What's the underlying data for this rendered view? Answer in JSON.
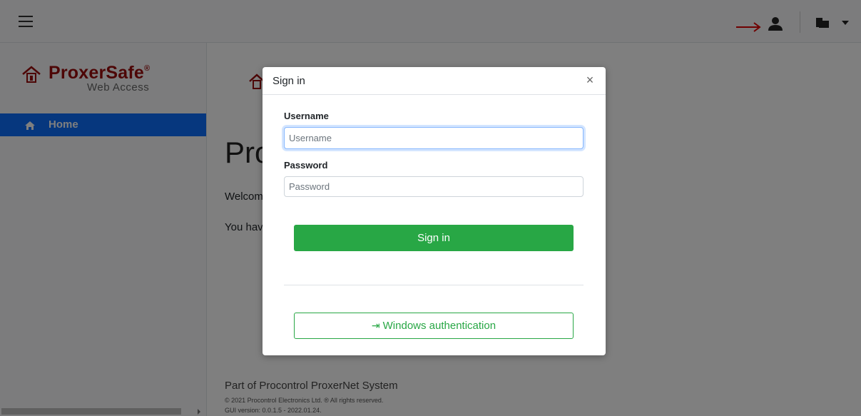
{
  "topbar": {
    "menu_icon": "hamburger-icon",
    "annotation_icon": "red-arrow-icon",
    "user_icon": "user-icon",
    "windows_icon": "windows-icon",
    "dropdown_icon": "caret-down-icon"
  },
  "sidebar": {
    "logo": {
      "brand": "ProxerSafe",
      "registered": "®",
      "subtitle": "Web Access"
    },
    "items": [
      {
        "label": "Home",
        "icon": "home-icon",
        "active": true
      }
    ]
  },
  "main": {
    "title": "Pro",
    "welcome": "Welcom",
    "have": "You hav"
  },
  "footer": {
    "title": "Part of Procontrol ProxerNet System",
    "copyright": "© 2021 Procontrol Electronics Ltd. ® All rights reserved.",
    "version": "GUI version: 0.0.1.5 - 2022.01.24."
  },
  "modal": {
    "title": "Sign in",
    "close": "×",
    "username_label": "Username",
    "username_placeholder": "Username",
    "username_value": "",
    "password_label": "Password",
    "password_placeholder": "Password",
    "password_value": "",
    "signin_button": "Sign in",
    "windows_button": "Windows authentication",
    "windows_button_icon": "login-icon"
  },
  "colors": {
    "primary": "#0d6efd",
    "success": "#28a745",
    "brand": "#9b0d0d",
    "annotation": "#e00000"
  }
}
